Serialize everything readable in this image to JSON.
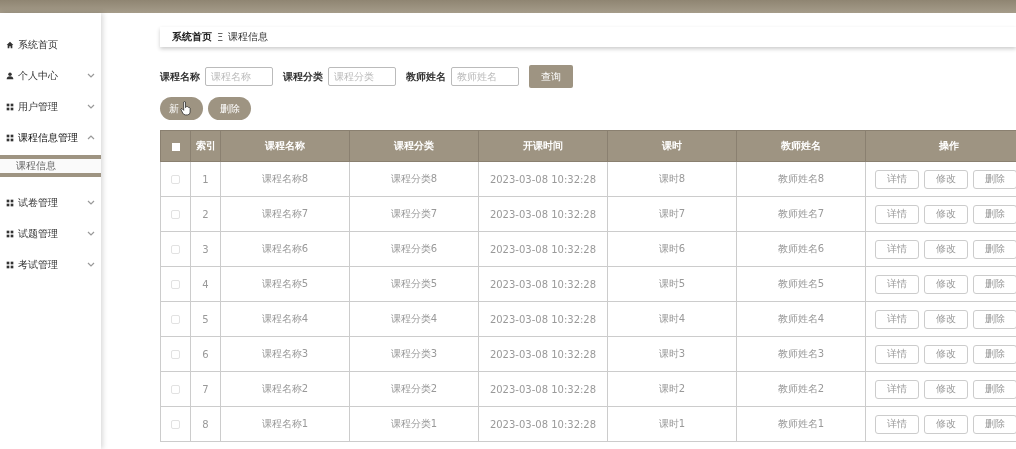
{
  "sidebar": {
    "items": [
      {
        "label": "系统首页",
        "kind": "home"
      },
      {
        "label": "个人中心",
        "kind": "person",
        "expanded": false
      },
      {
        "label": "用户管理",
        "kind": "grid",
        "expanded": false
      },
      {
        "label": "课程信息管理",
        "kind": "grid",
        "expanded": true,
        "children": [
          {
            "label": "课程信息",
            "selected": true
          }
        ]
      },
      {
        "label": "试卷管理",
        "kind": "grid",
        "expanded": false
      },
      {
        "label": "试题管理",
        "kind": "grid",
        "expanded": false
      },
      {
        "label": "考试管理",
        "kind": "grid",
        "expanded": false
      }
    ]
  },
  "breadcrumb": {
    "items": [
      "系统首页",
      "课程信息"
    ],
    "separator": "Ξ"
  },
  "search": {
    "fields": [
      {
        "label": "课程名称",
        "placeholder": "课程名称"
      },
      {
        "label": "课程分类",
        "placeholder": "课程分类"
      },
      {
        "label": "教师姓名",
        "placeholder": "教师姓名"
      }
    ],
    "button": "查询"
  },
  "actions": [
    "新",
    "删除"
  ],
  "table": {
    "all_checked": false,
    "columns": [
      "索引",
      "课程名称",
      "课程分类",
      "开课时间",
      "课时",
      "教师姓名",
      "操作"
    ],
    "rows": [
      {
        "checked": false,
        "cells": [
          "1",
          "课程名称8",
          "课程分类8",
          "2023-03-08 10:32:28",
          "课时8",
          "教师姓名8"
        ],
        "actions": [
          "详情",
          "修改",
          "删除"
        ]
      },
      {
        "checked": false,
        "cells": [
          "2",
          "课程名称7",
          "课程分类7",
          "2023-03-08 10:32:28",
          "课时7",
          "教师姓名7"
        ],
        "actions": [
          "详情",
          "修改",
          "删除"
        ]
      },
      {
        "checked": false,
        "cells": [
          "3",
          "课程名称6",
          "课程分类6",
          "2023-03-08 10:32:28",
          "课时6",
          "教师姓名6"
        ],
        "actions": [
          "详情",
          "修改",
          "删除"
        ]
      },
      {
        "checked": false,
        "cells": [
          "4",
          "课程名称5",
          "课程分类5",
          "2023-03-08 10:32:28",
          "课时5",
          "教师姓名5"
        ],
        "actions": [
          "详情",
          "修改",
          "删除"
        ]
      },
      {
        "checked": false,
        "cells": [
          "5",
          "课程名称4",
          "课程分类4",
          "2023-03-08 10:32:28",
          "课时4",
          "教师姓名4"
        ],
        "actions": [
          "详情",
          "修改",
          "删除"
        ]
      },
      {
        "checked": false,
        "cells": [
          "6",
          "课程名称3",
          "课程分类3",
          "2023-03-08 10:32:28",
          "课时3",
          "教师姓名3"
        ],
        "actions": [
          "详情",
          "修改",
          "删除"
        ]
      },
      {
        "checked": false,
        "cells": [
          "7",
          "课程名称2",
          "课程分类2",
          "2023-03-08 10:32:28",
          "课时2",
          "教师姓名2"
        ],
        "actions": [
          "详情",
          "修改",
          "删除"
        ]
      },
      {
        "checked": false,
        "cells": [
          "8",
          "课程名称1",
          "课程分类1",
          "2023-03-08 10:32:28",
          "课时1",
          "教师姓名1"
        ],
        "actions": [
          "详情",
          "修改",
          "删除"
        ]
      }
    ]
  }
}
